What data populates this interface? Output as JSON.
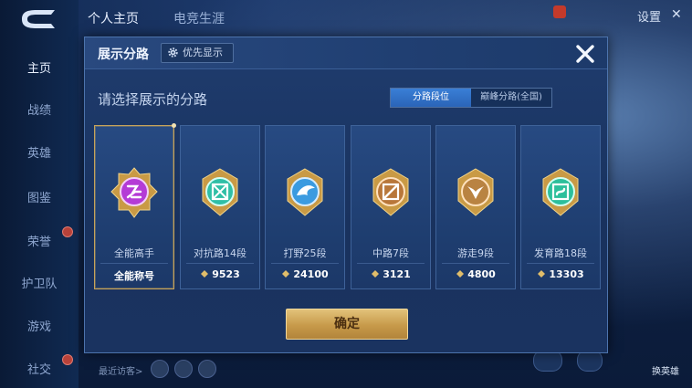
{
  "sidebar": {
    "items": [
      {
        "label": "主页",
        "active": true
      },
      {
        "label": "战绩"
      },
      {
        "label": "英雄"
      },
      {
        "label": "图鉴"
      },
      {
        "label": "荣誉"
      },
      {
        "label": "护卫队"
      },
      {
        "label": "游戏"
      },
      {
        "label": "社交"
      }
    ]
  },
  "top_tabs": [
    {
      "label": "个人主页",
      "active": true
    },
    {
      "label": "电竞生涯"
    }
  ],
  "top_right": {
    "settings_label": "设置",
    "close_glyph": "✕"
  },
  "footer": {
    "recent_visitors": "最近访客>"
  },
  "right_buttons": {
    "switch_hero": "换英雄"
  },
  "modal": {
    "title": "展示分路",
    "priority_label": "优先显示",
    "subtitle": "请选择展示的分路",
    "segments": [
      {
        "label": "分路段位",
        "active": true
      },
      {
        "label": "巅峰分路(全国)"
      }
    ],
    "cards": [
      {
        "name": "全能高手",
        "score": "全能称号",
        "icon": "all-round-badge-icon",
        "color": "#b43bd6",
        "selected": true
      },
      {
        "name": "对抗路14段",
        "score": "9523",
        "icon": "clash-lane-badge-icon",
        "color": "#2fbfa6"
      },
      {
        "name": "打野25段",
        "score": "24100",
        "icon": "jungle-badge-icon",
        "color": "#3b9be0"
      },
      {
        "name": "中路7段",
        "score": "3121",
        "icon": "mid-lane-badge-icon",
        "color": "#b8773a"
      },
      {
        "name": "游走9段",
        "score": "4800",
        "icon": "roam-badge-icon",
        "color": "#b98342"
      },
      {
        "name": "发育路18段",
        "score": "13303",
        "icon": "farm-lane-badge-icon",
        "color": "#2dbf9b"
      }
    ],
    "confirm_label": "确定"
  }
}
